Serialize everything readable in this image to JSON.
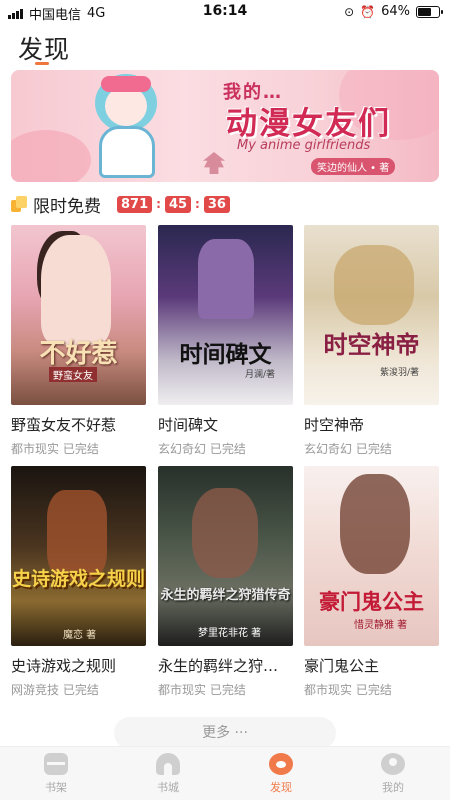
{
  "status_bar": {
    "carrier": "中国电信",
    "network": "4G",
    "time": "16:14",
    "battery": "64%",
    "battery_level": 0.64
  },
  "page": {
    "title": "发现",
    "accent_color": "#f0763f"
  },
  "banner": {
    "tag": "我的…",
    "heading": "动漫女友们",
    "subtitle": "My anime girlfriends",
    "author": "笑边的仙人 • 著"
  },
  "free_section": {
    "title": "限时免费",
    "countdown": [
      "871",
      "45",
      "36"
    ],
    "countdown_color": "#e24a4a"
  },
  "books": [
    {
      "name": "野蛮女友不好惹",
      "genre": "都市现实",
      "status": "已完结",
      "cover_title": "不好惹",
      "cover_sub": "野蛮女友"
    },
    {
      "name": "时间碑文",
      "genre": "玄幻奇幻",
      "status": "已完结",
      "cover_title": "时间碑文",
      "cover_author": "月澜/著"
    },
    {
      "name": "时空神帝",
      "genre": "玄幻奇幻",
      "status": "已完结",
      "cover_title": "时空神帝",
      "cover_author": "紫浚羽/著"
    },
    {
      "name": "史诗游戏之规则",
      "genre": "网游竞技",
      "status": "已完结",
      "cover_title": "史诗游戏之规则",
      "cover_author": "魔恋 著"
    },
    {
      "name": "永生的羁绊之狩…",
      "genre": "都市现实",
      "status": "已完结",
      "cover_title": "永生的羁绊之狩猎传奇",
      "cover_author": "梦里花非花 著"
    },
    {
      "name": "豪门鬼公主",
      "genre": "都市现实",
      "status": "已完结",
      "cover_title": "豪门鬼公主",
      "cover_author": "惜灵静雅 著"
    }
  ],
  "more_button": {
    "label": "更多 ···"
  },
  "tab_bar": {
    "tabs": [
      {
        "label": "书架",
        "icon": "bookshelf-icon"
      },
      {
        "label": "书城",
        "icon": "bookstore-icon"
      },
      {
        "label": "发现",
        "icon": "discover-icon",
        "active": true
      },
      {
        "label": "我的",
        "icon": "profile-icon"
      }
    ],
    "active_color": "#f07a4a",
    "inactive_color": "#aaaaaa"
  }
}
